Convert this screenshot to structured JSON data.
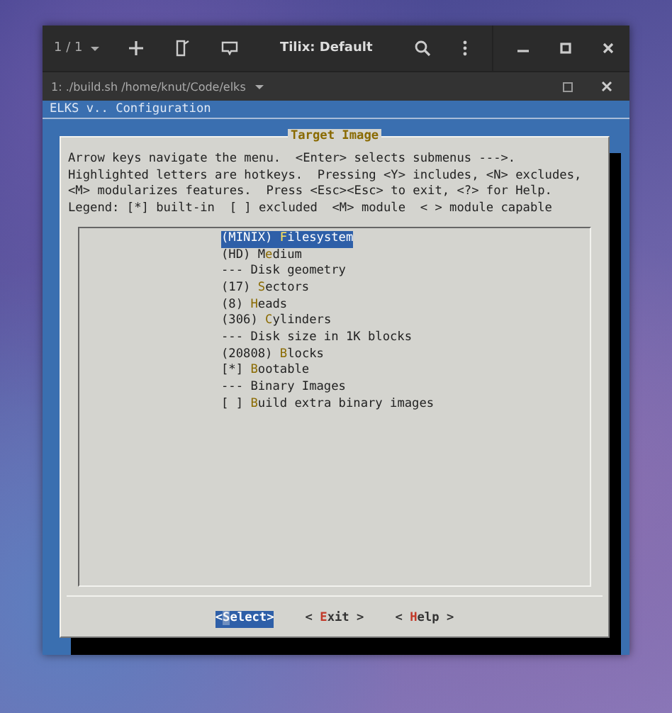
{
  "window": {
    "title": "Tilix: Default",
    "session": "1 / 1"
  },
  "terminal_tab": {
    "title": "1: ./build.sh /home/knut/Code/elks"
  },
  "terminal": {
    "header": "ELKS v.. Configuration",
    "dialog": {
      "title": "Target Image",
      "help_lines": [
        "Arrow keys navigate the menu.  <Enter> selects submenus --->.",
        "Highlighted letters are hotkeys.  Pressing <Y> includes, <N> excludes,",
        "<M> modularizes features.  Press <Esc><Esc> to exit, <?> for Help.",
        "Legend: [*] built-in  [ ] excluded  <M> module  < > module capable"
      ],
      "menu": [
        {
          "kind": "option",
          "prefix": "(MINIX) ",
          "key": "F",
          "rest": "ilesystem",
          "selected": true
        },
        {
          "kind": "option",
          "prefix": "(HD) M",
          "key": "e",
          "rest": "dium",
          "selected": false
        },
        {
          "kind": "section",
          "text": "--- Disk geometry"
        },
        {
          "kind": "option",
          "prefix": "(17) ",
          "key": "S",
          "rest": "ectors",
          "selected": false
        },
        {
          "kind": "option",
          "prefix": "(8) ",
          "key": "H",
          "rest": "eads",
          "selected": false
        },
        {
          "kind": "option",
          "prefix": "(306) ",
          "key": "C",
          "rest": "ylinders",
          "selected": false
        },
        {
          "kind": "section",
          "text": "--- Disk size in 1K blocks"
        },
        {
          "kind": "option",
          "prefix": "(20808) ",
          "key": "B",
          "rest": "locks",
          "selected": false
        },
        {
          "kind": "option",
          "prefix": "[*] ",
          "key": "B",
          "rest": "ootable",
          "selected": false
        },
        {
          "kind": "section",
          "text": "--- Binary Images"
        },
        {
          "kind": "option",
          "prefix": "[ ] ",
          "key": "B",
          "rest": "uild extra binary images",
          "selected": false
        }
      ],
      "buttons": [
        {
          "left": "<",
          "key": "S",
          "rest": "elect",
          "right": ">",
          "selected": true
        },
        {
          "left": "< ",
          "key": "E",
          "rest": "xit",
          "right": " >",
          "selected": false
        },
        {
          "left": "< ",
          "key": "H",
          "rest": "elp",
          "right": " >",
          "selected": false
        }
      ]
    }
  }
}
